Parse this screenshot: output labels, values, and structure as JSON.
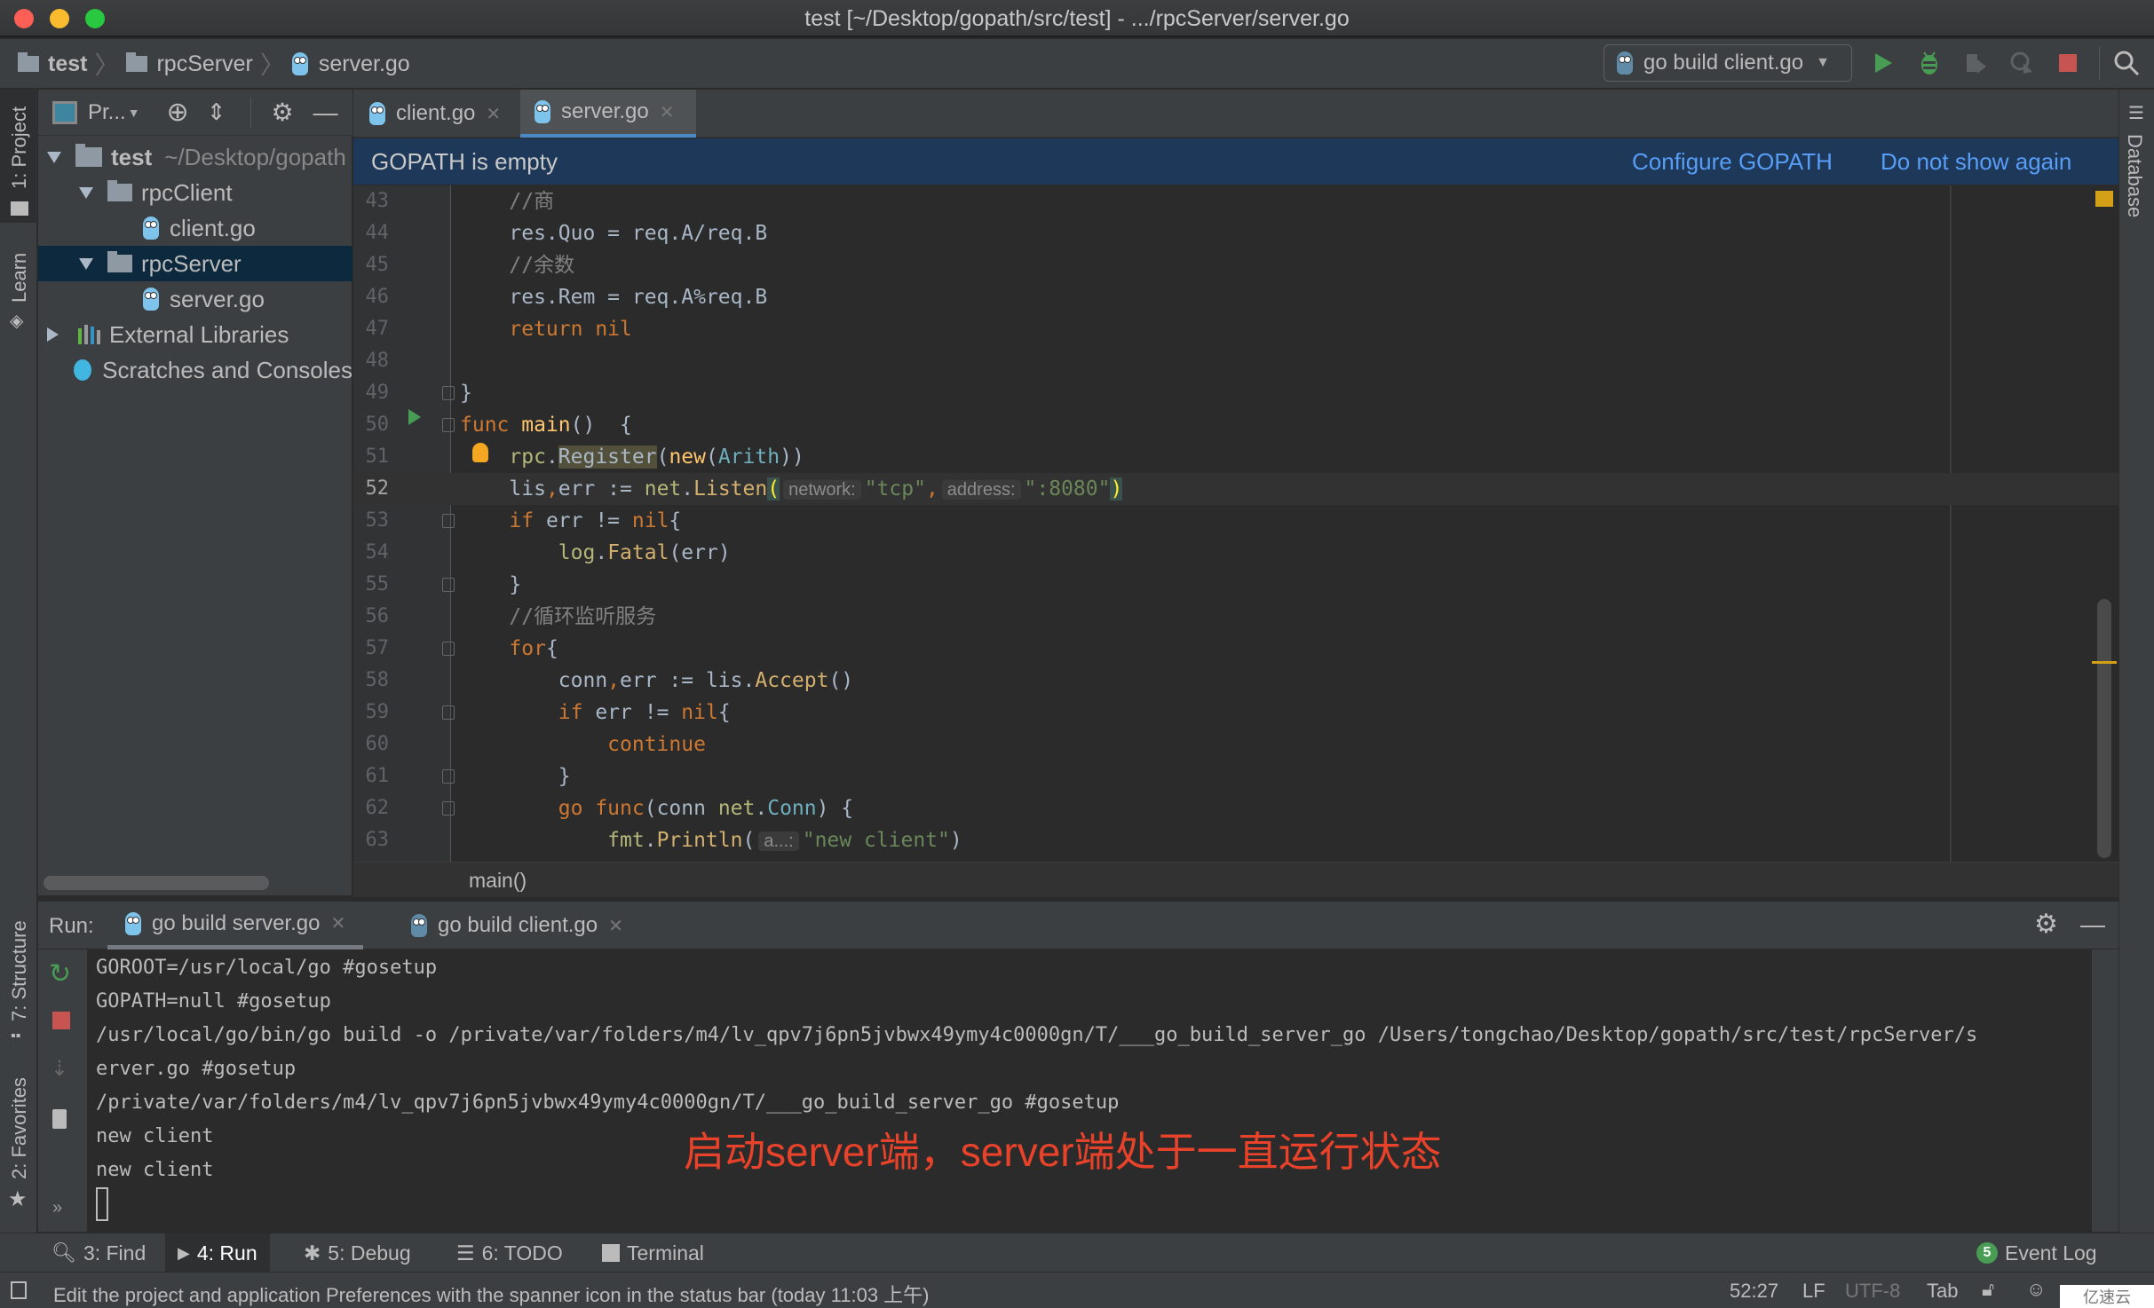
{
  "window": {
    "title": "test [~/Desktop/gopath/src/test] - .../rpcServer/server.go"
  },
  "navbar": {
    "breadcrumbs": [
      "test",
      "rpcServer",
      "server.go"
    ],
    "run_config": "go build client.go"
  },
  "left_strip": {
    "project_label": "1: Project",
    "learn_label": "Learn",
    "structure_label": "7: Structure",
    "favorites_label": "2: Favorites"
  },
  "right_strip": {
    "database_label": "Database"
  },
  "project_panel": {
    "view_selector": "Pr...",
    "tree": [
      {
        "name": "test",
        "detail": "~/Desktop/gopath",
        "type": "folder",
        "expanded": true
      },
      {
        "name": "rpcClient",
        "type": "folder",
        "expanded": true
      },
      {
        "name": "client.go",
        "type": "go-file"
      },
      {
        "name": "rpcServer",
        "type": "folder",
        "expanded": true,
        "selected": true
      },
      {
        "name": "server.go",
        "type": "go-file"
      },
      {
        "name": "External Libraries",
        "type": "libraries",
        "expanded": false
      },
      {
        "name": "Scratches and Consoles",
        "type": "scratches"
      }
    ]
  },
  "editor_tabs": [
    {
      "label": "client.go",
      "active": false
    },
    {
      "label": "server.go",
      "active": true
    }
  ],
  "banner": {
    "message": "GOPATH is empty",
    "configure": "Configure GOPATH",
    "dismiss": "Do not show again"
  },
  "editor": {
    "current_line": 52,
    "lines": [
      {
        "n": "43",
        "indent": "    ",
        "tokens": [
          [
            "cm",
            "//商"
          ]
        ]
      },
      {
        "n": "44",
        "indent": "    ",
        "tokens": [
          [
            "",
            "res.Quo = req.A/req.B"
          ]
        ]
      },
      {
        "n": "45",
        "indent": "    ",
        "tokens": [
          [
            "cm",
            "//余数"
          ]
        ]
      },
      {
        "n": "46",
        "indent": "    ",
        "tokens": [
          [
            "",
            "res.Rem = req.A%req.B"
          ]
        ]
      },
      {
        "n": "47",
        "indent": "    ",
        "tokens": [
          [
            "kw",
            "return nil"
          ]
        ]
      },
      {
        "n": "48",
        "indent": "",
        "tokens": []
      },
      {
        "n": "49",
        "indent": "",
        "tokens": [
          [
            "",
            "}"
          ]
        ]
      },
      {
        "n": "50",
        "indent": "",
        "tokens": [
          [
            "kw",
            "func "
          ],
          [
            "fn",
            "main"
          ],
          [
            "",
            "()  {"
          ]
        ]
      },
      {
        "n": "51",
        "indent": "    ",
        "tokens": [
          [
            "pkg",
            "rpc"
          ],
          [
            "",
            "."
          ],
          [
            "hl",
            "Register"
          ],
          [
            "",
            "("
          ],
          [
            "fn",
            "new"
          ],
          [
            "",
            "("
          ],
          [
            "typ",
            "Arith"
          ],
          [
            "",
            "))"
          ]
        ]
      },
      {
        "n": "52",
        "indent": "    ",
        "tokens": [
          [
            "",
            "lis"
          ],
          [
            "kw",
            ","
          ],
          [
            "",
            "err := "
          ],
          [
            "pkg",
            "net"
          ],
          [
            "",
            "."
          ],
          [
            "meth",
            "Listen"
          ],
          [
            "brk",
            "("
          ],
          [
            "hint",
            "network:"
          ],
          [
            "str",
            "\"tcp\""
          ],
          [
            "kw",
            ","
          ],
          [
            "hint",
            "address:"
          ],
          [
            "str",
            "\":8080\""
          ],
          [
            "brk",
            ")"
          ]
        ]
      },
      {
        "n": "53",
        "indent": "    ",
        "tokens": [
          [
            "kw",
            "if "
          ],
          [
            "",
            "err != "
          ],
          [
            "kw",
            "nil"
          ],
          [
            "",
            "{"
          ]
        ]
      },
      {
        "n": "54",
        "indent": "        ",
        "tokens": [
          [
            "pkg",
            "log"
          ],
          [
            "",
            "."
          ],
          [
            "meth",
            "Fatal"
          ],
          [
            "",
            "(err)"
          ]
        ]
      },
      {
        "n": "55",
        "indent": "    ",
        "tokens": [
          [
            "",
            "}"
          ]
        ]
      },
      {
        "n": "56",
        "indent": "    ",
        "tokens": [
          [
            "cm",
            "//循环监听服务"
          ]
        ]
      },
      {
        "n": "57",
        "indent": "    ",
        "tokens": [
          [
            "kw",
            "for"
          ],
          [
            "",
            "{"
          ]
        ]
      },
      {
        "n": "58",
        "indent": "        ",
        "tokens": [
          [
            "",
            "conn"
          ],
          [
            "kw",
            ","
          ],
          [
            "",
            "err := lis."
          ],
          [
            "meth",
            "Accept"
          ],
          [
            "",
            "()"
          ]
        ]
      },
      {
        "n": "59",
        "indent": "        ",
        "tokens": [
          [
            "kw",
            "if "
          ],
          [
            "",
            "err != "
          ],
          [
            "kw",
            "nil"
          ],
          [
            "",
            "{"
          ]
        ]
      },
      {
        "n": "60",
        "indent": "            ",
        "tokens": [
          [
            "kw",
            "continue"
          ]
        ]
      },
      {
        "n": "61",
        "indent": "        ",
        "tokens": [
          [
            "",
            "}"
          ]
        ]
      },
      {
        "n": "62",
        "indent": "        ",
        "tokens": [
          [
            "kw",
            "go func"
          ],
          [
            "",
            "(conn "
          ],
          [
            "pkg",
            "net"
          ],
          [
            "",
            "."
          ],
          [
            "typ",
            "Conn"
          ],
          [
            "",
            ") {"
          ]
        ]
      },
      {
        "n": "63",
        "indent": "            ",
        "tokens": [
          [
            "pkg",
            "fmt"
          ],
          [
            "",
            "."
          ],
          [
            "meth",
            "Println"
          ],
          [
            "",
            "("
          ],
          [
            "hint",
            "a...:"
          ],
          [
            "str",
            "\"new client\""
          ],
          [
            "",
            ")"
          ]
        ]
      }
    ],
    "breadcrumb": "main()"
  },
  "run_panel": {
    "label": "Run:",
    "tabs": [
      {
        "label": "go build server.go",
        "active": true
      },
      {
        "label": "go build client.go",
        "active": false
      }
    ],
    "console_lines": [
      "GOROOT=/usr/local/go #gosetup",
      "GOPATH=null #gosetup",
      "/usr/local/go/bin/go build -o /private/var/folders/m4/lv_qpv7j6pn5jvbwx49ymy4c0000gn/T/___go_build_server_go /Users/tongchao/Desktop/gopath/src/test/rpcServer/s",
      "erver.go #gosetup",
      "/private/var/folders/m4/lv_qpv7j6pn5jvbwx49ymy4c0000gn/T/___go_build_server_go #gosetup",
      "new client",
      "new client"
    ],
    "annotation": "启动server端，server端处于一直运行状态",
    "annotation_color": "#e8432a"
  },
  "tool_windows": [
    {
      "key": "3",
      "label": "3: Find",
      "icon": "search-icon",
      "active": false
    },
    {
      "key": "4",
      "label": "4: Run",
      "icon": "run-icon",
      "active": true
    },
    {
      "key": "5",
      "label": "5: Debug",
      "icon": "bug-icon",
      "active": false
    },
    {
      "key": "6",
      "label": "6: TODO",
      "icon": "list-icon",
      "active": false
    },
    {
      "key": "",
      "label": "Terminal",
      "icon": "terminal-icon",
      "active": false
    }
  ],
  "event_log": {
    "count": "5",
    "label": "Event Log"
  },
  "status_bar": {
    "message": "Edit the project and application Preferences with the spanner icon in the status bar (today 11:03 上午)",
    "position": "52:27",
    "line_separator": "LF",
    "encoding": "UTF-8",
    "indent": "Tab"
  },
  "watermark": "亿速云",
  "colors": {
    "accent": "#4a88c7",
    "banner_bg": "#1d3858",
    "link": "#589df6",
    "run_green": "#499c54",
    "stop_red": "#c75450"
  }
}
